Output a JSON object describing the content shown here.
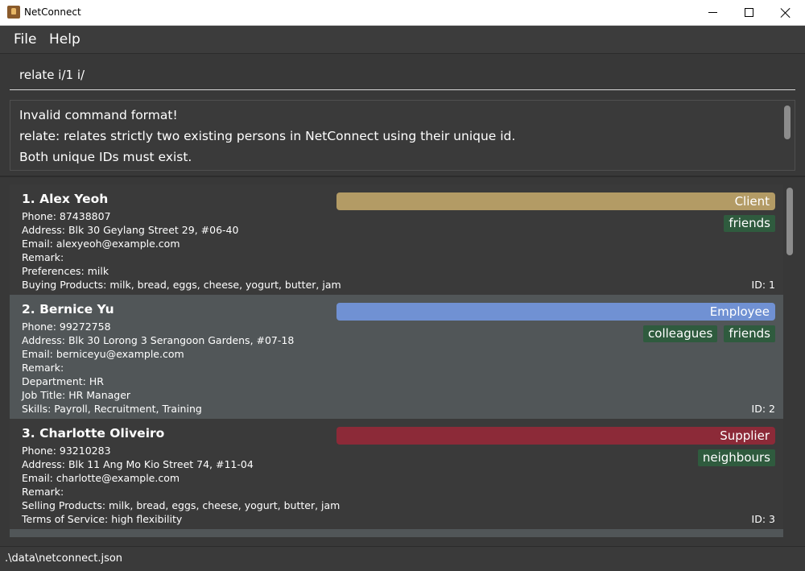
{
  "window": {
    "title": "NetConnect"
  },
  "menu": {
    "file": "File",
    "help": "Help"
  },
  "command": {
    "value": "relate i/1 i/"
  },
  "result": {
    "lines": [
      "Invalid command format!",
      "relate: relates strictly two existing persons in NetConnect using their unique id.",
      "Both unique IDs must exist."
    ]
  },
  "persons": [
    {
      "name": "1.  Alex Yeoh",
      "role": "Client",
      "role_color": "#b39b65",
      "tags": [
        "friends"
      ],
      "fields": [
        "Phone: 87438807",
        "Address: Blk 30 Geylang Street 29, #06-40",
        "Email: alexyeoh@example.com",
        "Remark:",
        "Preferences: milk",
        "Buying Products: milk, bread, eggs, cheese, yogurt, butter, jam"
      ],
      "id": "ID: 1"
    },
    {
      "name": "2.  Bernice Yu",
      "role": "Employee",
      "role_color": "#7091d3",
      "tags": [
        "colleagues",
        "friends"
      ],
      "fields": [
        "Phone: 99272758",
        "Address: Blk 30 Lorong 3 Serangoon Gardens, #07-18",
        "Email: berniceyu@example.com",
        "Remark:",
        "Department: HR",
        "Job Title: HR Manager",
        "Skills: Payroll, Recruitment, Training"
      ],
      "id": "ID: 2"
    },
    {
      "name": "3.  Charlotte Oliveiro",
      "role": "Supplier",
      "role_color": "#8c2a38",
      "tags": [
        "neighbours"
      ],
      "fields": [
        "Phone: 93210283",
        "Address: Blk 11 Ang Mo Kio Street 74, #11-04",
        "Email: charlotte@example.com",
        "Remark:",
        "Selling Products: milk, bread, eggs, cheese, yogurt, butter, jam",
        "Terms of Service: high flexibility"
      ],
      "id": "ID: 3"
    }
  ],
  "status": {
    "path": ".\\data\\netconnect.json"
  }
}
